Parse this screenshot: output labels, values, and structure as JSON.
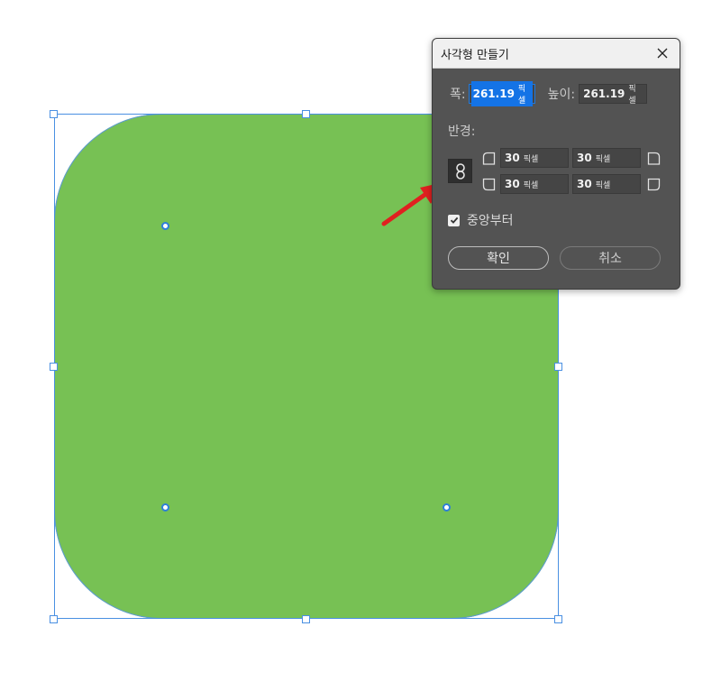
{
  "dialog": {
    "title": "사각형 만들기",
    "width_label": "폭:",
    "width_value": "261.19",
    "width_unit": "픽셀",
    "height_label": "높이:",
    "height_value": "261.19",
    "height_unit": "픽셀",
    "radius_label": "반경:",
    "radius_unit": "픽셀",
    "radius_top_left": "30",
    "radius_top_right": "30",
    "radius_bottom_left": "30",
    "radius_bottom_right": "30",
    "center_label": "중앙부터",
    "center_checked": true,
    "ok_label": "확인",
    "cancel_label": "취소"
  },
  "canvas": {
    "shape_fill": "#77c154",
    "selection_color": "#4a90e2",
    "arrow_color": "#e02020"
  },
  "icons": [
    "close-icon",
    "link-icon",
    "corner-icon",
    "checkmark-icon",
    "arrow-annotation"
  ]
}
